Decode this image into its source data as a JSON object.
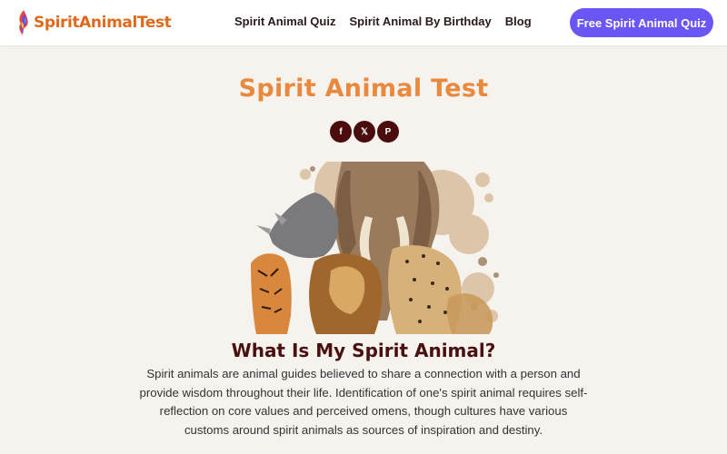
{
  "header": {
    "logo_text": "SpiritAnimalTest",
    "nav": [
      {
        "label": "Spirit Animal Quiz"
      },
      {
        "label": "Spirit Animal By Birthday"
      },
      {
        "label": "Blog"
      }
    ],
    "cta_label": "Free Spirit Animal Quiz"
  },
  "main": {
    "title": "Spirit Animal Test",
    "share": [
      {
        "icon": "facebook-icon",
        "glyph": "f"
      },
      {
        "icon": "x-icon",
        "glyph": "𝕏"
      },
      {
        "icon": "pinterest-icon",
        "glyph": "P"
      }
    ],
    "hero_image": {
      "icon": "animals-collage-image"
    },
    "section_heading": "What Is My Spirit Animal?",
    "intro": "Spirit animals are animal guides believed to share a connection with a person and provide wisdom throughout their life. Identification of one's spirit animal requires self-reflection on core values and perceived omens, though cultures have various customs around spirit animals as sources of inspiration and destiny."
  },
  "colors": {
    "background": "#f6f2ee",
    "header_bg": "#ffffff",
    "logo_orange": "#e06a1c",
    "title_orange": "#e8893e",
    "cta_purple": "#6a56f4",
    "dark_maroon": "#4a0c0c"
  }
}
